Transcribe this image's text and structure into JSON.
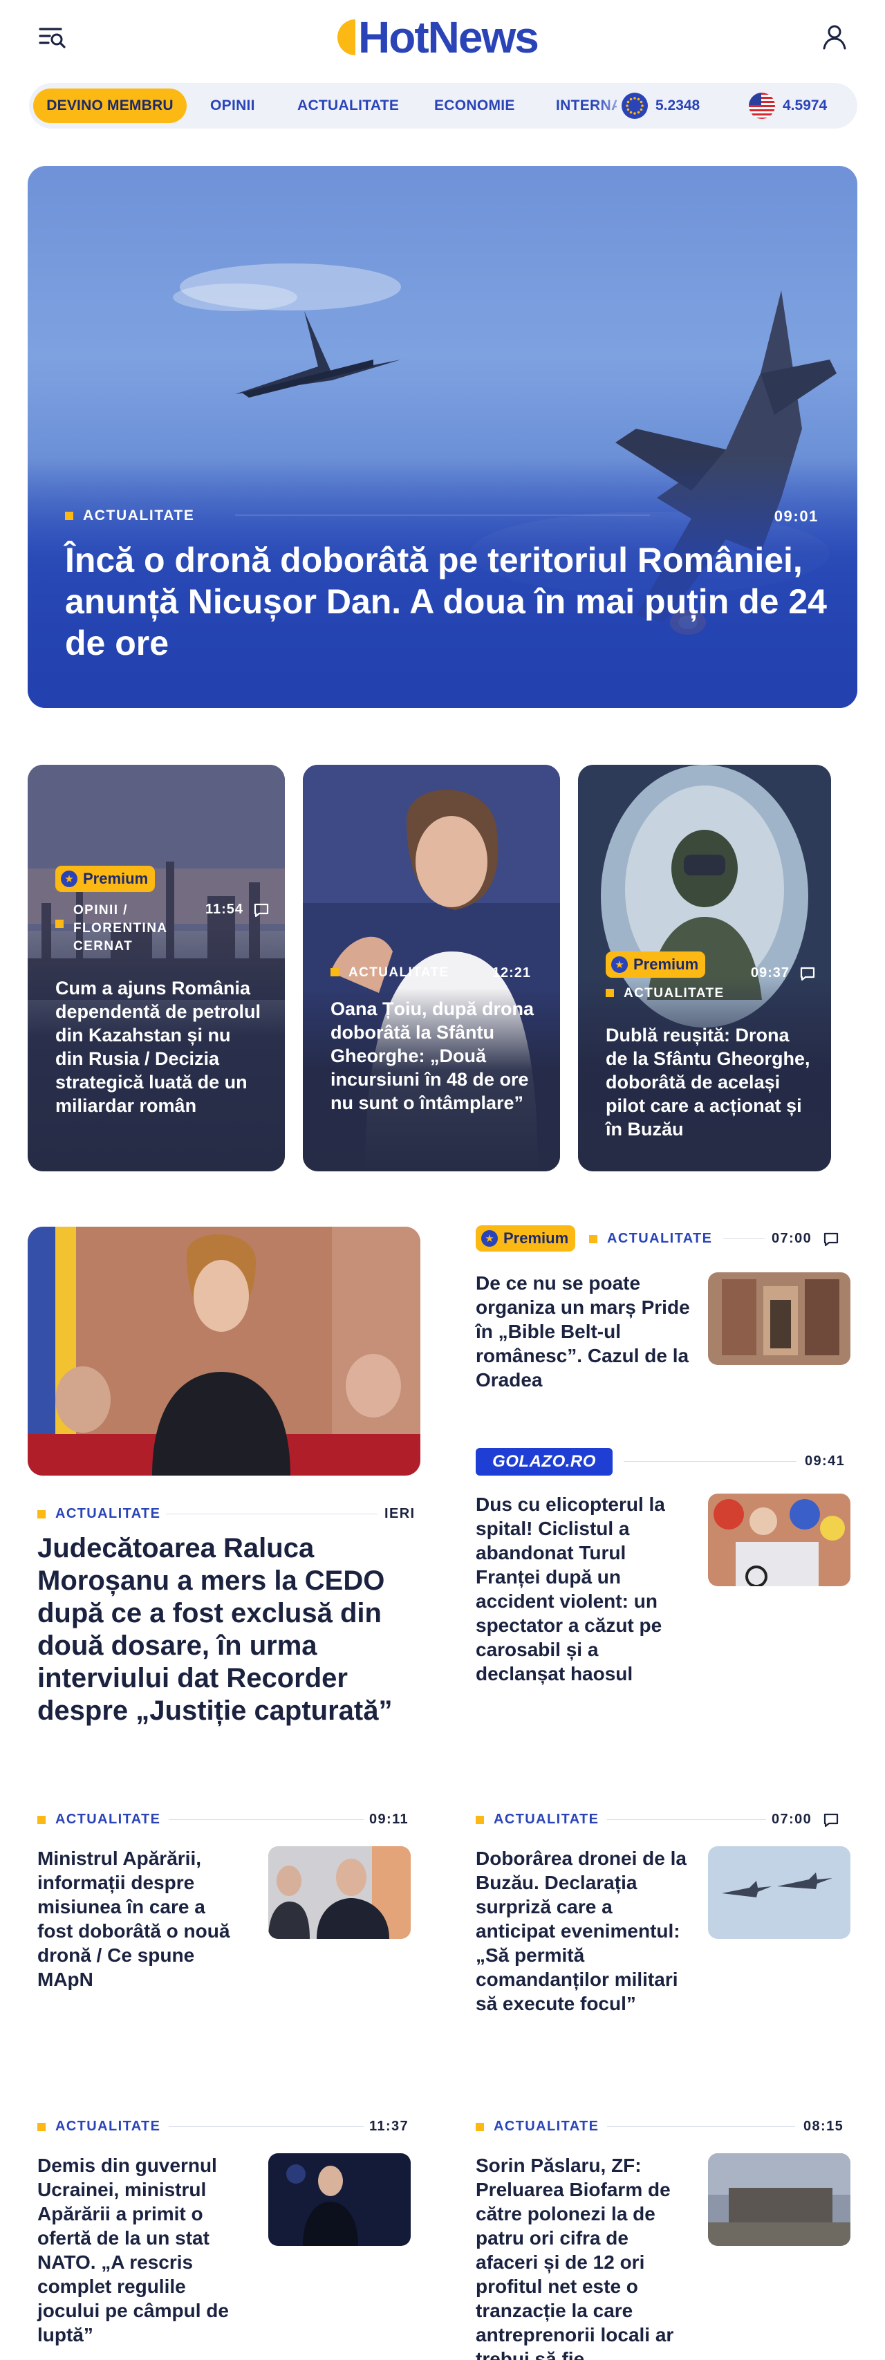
{
  "header": {
    "logo_text": "HotNews",
    "menu_icon": "menu-search-icon",
    "user_icon": "user-icon",
    "brand_blue": "#2a44b8",
    "brand_yellow": "#fdb913"
  },
  "nav": {
    "member_label": "DEVINO MEMBRU",
    "links": [
      "OPINII",
      "ACTUALITATE",
      "ECONOMIE",
      "INTERNAȚIONAL"
    ],
    "eur_value": "5.2348",
    "usd_value": "4.5974"
  },
  "hero": {
    "category": "ACTUALITATE",
    "time": "09:01",
    "title": "Încă o dronă doborâtă pe teritoriul României, anunță Nicușor Dan. A doua în mai puțin de 24 de ore"
  },
  "cards": [
    {
      "premium_label": "Premium",
      "category": "OPINII / FLORENTINA CERNAT",
      "time": "11:54",
      "title": "Cum a ajuns România dependentă de petrolul din Kazahstan și nu din Rusia / Decizia strategică luată de un miliardar român"
    },
    {
      "category": "ACTUALITATE",
      "time": "12:21",
      "title": "Oana Țoiu, după drona doborâtă la Sfântu Gheorghe: „Două incursiuni în 48 de ore nu sunt o întâmplare”"
    },
    {
      "premium_label": "Premium",
      "category": "ACTUALITATE",
      "time": "09:37",
      "title": "Dublă reușită: Drona de la Sfântu Gheorghe, doborâtă de același pilot care a acționat și în Buzău"
    }
  ],
  "feature": {
    "category": "ACTUALITATE",
    "time": "IERI",
    "title": "Judecătoarea Raluca Moroșanu a mers la CEDO după ce a fost exclusă din două dosare, în urma interviului dat Recorder despre „Justiție capturată”"
  },
  "side": [
    {
      "premium_label": "Premium",
      "category": "ACTUALITATE",
      "time": "07:00",
      "title": "De ce nu se poate organiza un marș Pride în „Bible Belt-ul românesc”. Cazul de la Oradea"
    },
    {
      "source_label": "GOLAZO.RO",
      "time": "09:41",
      "title": "Dus cu elicopterul la spital! Ciclistul a abandonat Turul Franței după un accident violent: un spectator a căzut pe carosabil și a declanșat haosul"
    }
  ],
  "grid": [
    {
      "category": "ACTUALITATE",
      "time": "09:11",
      "title": "Ministrul Apărării, informații despre misiunea în care a fost doborâtă o nouă dronă / Ce spune MApN"
    },
    {
      "category": "ACTUALITATE",
      "time": "07:00",
      "title": "Doborârea dronei de la Buzău. Declarația surpriză care a anticipat evenimentul: „Să permită comandanților militari să execute focul”"
    },
    {
      "category": "ACTUALITATE",
      "time": "11:37",
      "title": "Demis din guvernul Ucrainei, ministrul Apărării a primit o ofertă de la un stat NATO. „A rescris complet regulile jocului pe câmpul de luptă”"
    },
    {
      "category": "ACTUALITATE",
      "time": "08:15",
      "title": "Sorin Păslaru, ZF: Preluarea Biofarm de către polonezi la de patru ori cifra de afaceri și de 12 ori profitul net este o tranzacție la care antreprenorii locali ar trebui să fie"
    }
  ]
}
